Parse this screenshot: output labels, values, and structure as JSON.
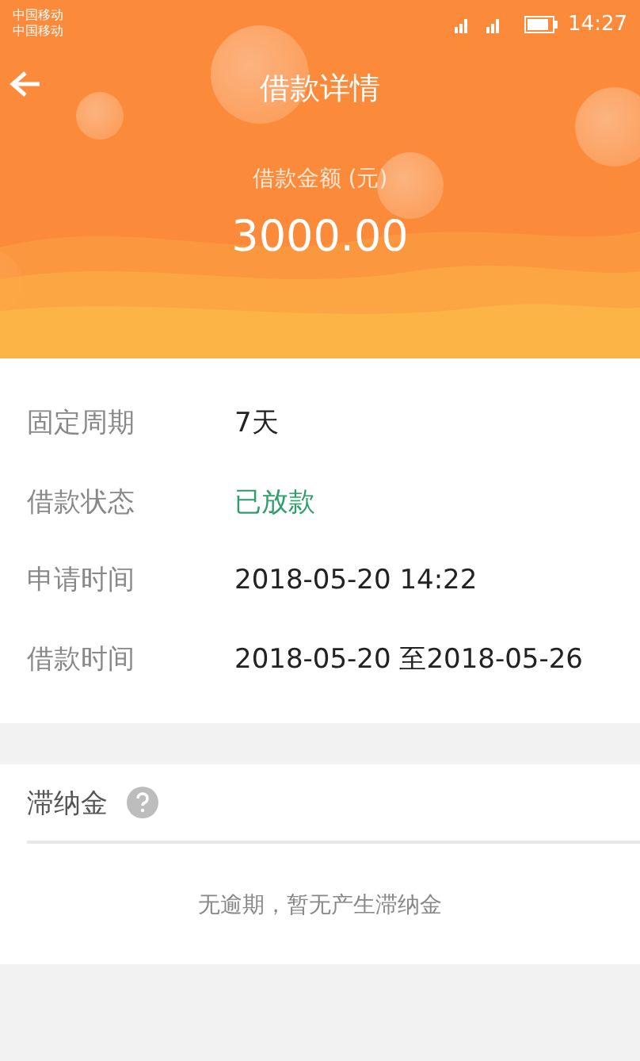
{
  "status_bar": {
    "carriers": [
      "中国移动",
      "中国移动"
    ],
    "time": "14:27"
  },
  "nav": {
    "title": "借款详情"
  },
  "summary": {
    "label": "借款金额 (元)",
    "amount": "3000.00"
  },
  "details": [
    {
      "label": "固定周期",
      "value": "7天",
      "kind": "plain"
    },
    {
      "label": "借款状态",
      "value": "已放款",
      "kind": "status"
    },
    {
      "label": "申请时间",
      "value": "2018-05-20  14:22",
      "kind": "plain"
    },
    {
      "label": "借款时间",
      "value": "2018-05-20 至2018-05-26",
      "kind": "plain"
    }
  ],
  "late_fee": {
    "title": "滞纳金",
    "message": "无逾期，暂无产生滞纳金"
  }
}
